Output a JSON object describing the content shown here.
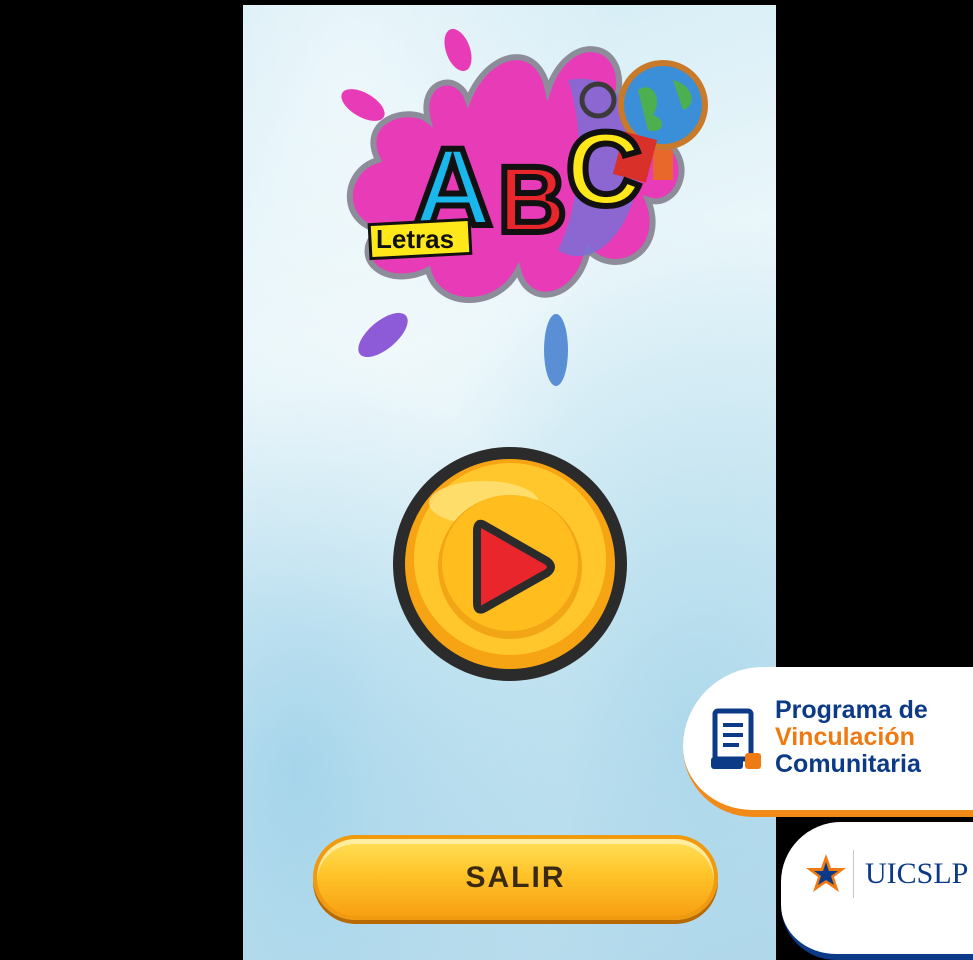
{
  "logo": {
    "letters": [
      "A",
      "B",
      "C"
    ],
    "subtitle": "Letras"
  },
  "play_button": {
    "icon": "play-icon"
  },
  "exit_button": {
    "label": "SALIR"
  },
  "badges": {
    "program": {
      "line1": "Programa de",
      "line2": "Vinculación",
      "line3": "Comunitaria",
      "icon": "document-icon"
    },
    "university": {
      "name": "UICSLP",
      "icon": "star-logo-icon"
    }
  },
  "colors": {
    "yellow": "#FFC42A",
    "red_play": "#E8262C",
    "navy": "#0C3A86",
    "orange": "#F07A12"
  }
}
